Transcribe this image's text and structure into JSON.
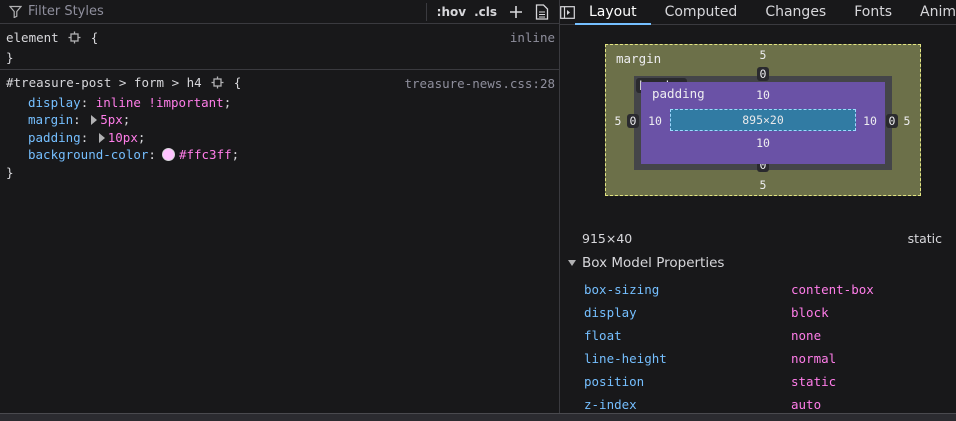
{
  "rules": {
    "filter_placeholder": "Filter Styles",
    "hov_label": ":hov",
    "cls_label": ".cls",
    "element_rule": {
      "selector": "element",
      "open": "{",
      "close": "}",
      "source": "inline"
    },
    "rule2": {
      "selector": "#treasure-post > form > h4",
      "open": "{",
      "close": "}",
      "source": "treasure-news.css:28",
      "declarations": [
        {
          "name": "display",
          "value": "inline !important"
        },
        {
          "name": "margin",
          "value": "5px"
        },
        {
          "name": "padding",
          "value": "10px"
        },
        {
          "name": "background-color",
          "value": "#ffc3ff"
        }
      ]
    }
  },
  "layout_panel": {
    "tabs": [
      "Layout",
      "Computed",
      "Changes",
      "Fonts",
      "Animations"
    ],
    "active_tab": "Layout",
    "box_model": {
      "margin_label": "margin",
      "border_label": "border",
      "padding_label": "padding",
      "margin": {
        "top": "5",
        "right": "5",
        "bottom": "5",
        "left": "5"
      },
      "border": {
        "top": "0",
        "right": "0",
        "bottom": "0",
        "left": "0"
      },
      "padding": {
        "top": "10",
        "right": "10",
        "bottom": "10",
        "left": "10"
      },
      "content": "895×20"
    },
    "dimensions": "915×40",
    "position_value": "static",
    "props_header": "Box Model Properties",
    "properties": [
      {
        "name": "box-sizing",
        "value": "content-box"
      },
      {
        "name": "display",
        "value": "block"
      },
      {
        "name": "float",
        "value": "none"
      },
      {
        "name": "line-height",
        "value": "normal"
      },
      {
        "name": "position",
        "value": "static"
      },
      {
        "name": "z-index",
        "value": "auto"
      }
    ]
  },
  "colors": {
    "swatch": "#ffc3ff",
    "accent": "#75bfff",
    "value": "#ff7de9"
  }
}
